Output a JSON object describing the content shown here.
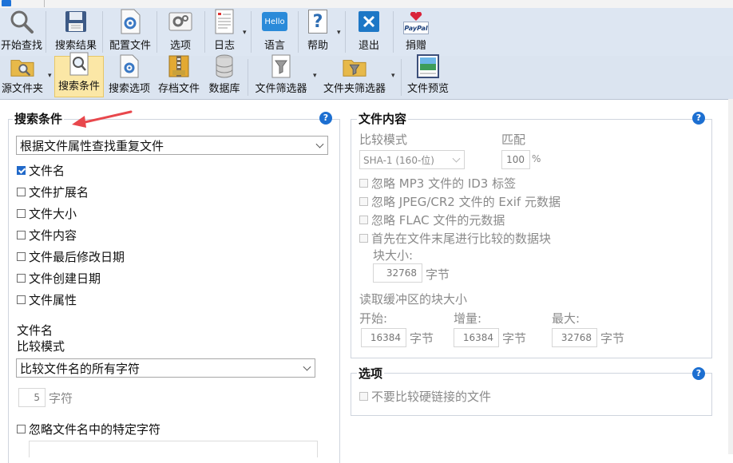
{
  "toolbar1": {
    "items": [
      {
        "label": "开始查找",
        "icon": "magnifier-icon"
      },
      {
        "label": "搜索结果",
        "icon": "floppy-disk-icon"
      },
      {
        "label": "配置文件",
        "icon": "gear-document-icon"
      },
      {
        "label": "选项",
        "icon": "options-gear-icon"
      },
      {
        "label": "日志",
        "icon": "log-document-icon"
      },
      {
        "label": "语言",
        "icon": "hello-bubble-icon",
        "icon_text": "Hello"
      },
      {
        "label": "帮助",
        "icon": "help-question-icon",
        "icon_text": "?"
      },
      {
        "label": "退出",
        "icon": "exit-x-icon"
      },
      {
        "label": "捐赠",
        "icon": "paypal-heart-icon",
        "icon_text": "PayPal"
      }
    ]
  },
  "toolbar2": {
    "items": [
      {
        "label": "源文件夹",
        "icon": "source-folder-icon"
      },
      {
        "label": "搜索条件",
        "icon": "search-criteria-icon"
      },
      {
        "label": "搜索选项",
        "icon": "search-options-icon"
      },
      {
        "label": "存档文件",
        "icon": "archive-zip-icon"
      },
      {
        "label": "数据库",
        "icon": "database-icon"
      },
      {
        "label": "文件筛选器",
        "icon": "file-filter-icon"
      },
      {
        "label": "文件夹筛选器",
        "icon": "folder-filter-icon"
      },
      {
        "label": "文件预览",
        "icon": "file-preview-icon"
      }
    ]
  },
  "criteria": {
    "title": "搜索条件",
    "mode": "根据文件属性查找重复文件",
    "checks": [
      {
        "label": "文件名",
        "checked": true
      },
      {
        "label": "文件扩展名",
        "checked": false
      },
      {
        "label": "文件大小",
        "checked": false
      },
      {
        "label": "文件内容",
        "checked": false
      },
      {
        "label": "文件最后修改日期",
        "checked": false
      },
      {
        "label": "文件创建日期",
        "checked": false
      },
      {
        "label": "文件属性",
        "checked": false
      }
    ],
    "filename_label": "文件名",
    "compare_label": "比较模式",
    "compare_mode": "比较文件名的所有字符",
    "chars_value": "5",
    "chars_unit": "字符",
    "ignore_chars_label": "忽略文件名中的特定字符"
  },
  "content": {
    "title": "文件内容",
    "compare_label": "比较模式",
    "match_label": "匹配",
    "hash_mode": "SHA-1 (160-位)",
    "match_value": "100",
    "match_unit": "%",
    "ignore_mp3": "忽略 MP3 文件的 ID3 标签",
    "ignore_jpeg": "忽略 JPEG/CR2 文件的 Exif 元数据",
    "ignore_flac": "忽略 FLAC 文件的元数据",
    "tail_compare": "首先在文件末尾进行比较的数据块",
    "block_size_label": "块大小:",
    "block_size_value": "32768",
    "bytes_unit": "字节",
    "buffer_label": "读取缓冲区的块大小",
    "start_label": "开始:",
    "start_value": "16384",
    "increment_label": "增量:",
    "increment_value": "16384",
    "max_label": "最大:",
    "max_value": "32768"
  },
  "options": {
    "title": "选项",
    "no_hardlinks": "不要比较硬链接的文件"
  },
  "colors": {
    "accent_blue": "#1c6fd1",
    "arrow_red": "#e8474c",
    "active_button": "#fbe7a6"
  }
}
